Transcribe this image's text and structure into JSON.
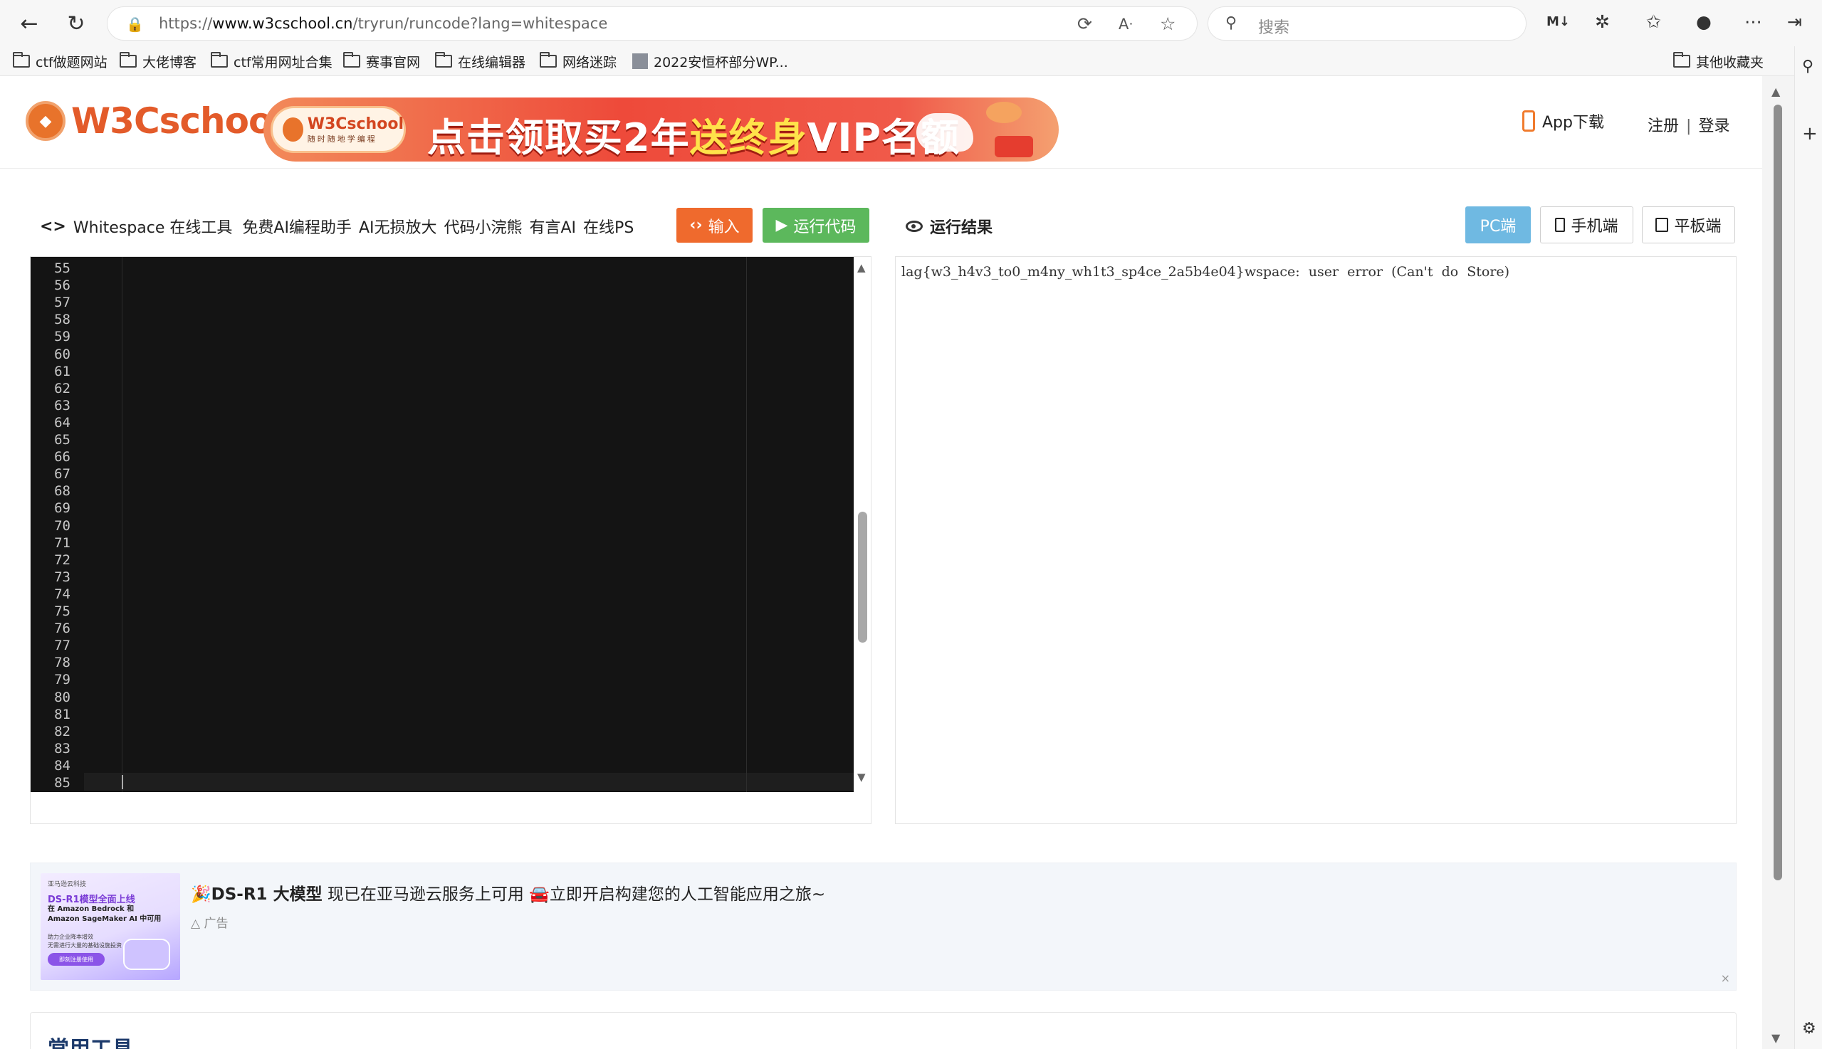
{
  "browser": {
    "url_prefix": "https://",
    "url_host": "www.w3cschool.cn",
    "url_path": "/tryrun/runcode?lang=whitespace",
    "search_placeholder": "搜索",
    "bookmarks": [
      {
        "label": "ctf做题网站",
        "type": "folder"
      },
      {
        "label": "大佬博客",
        "type": "folder"
      },
      {
        "label": "ctf常用网址合集",
        "type": "folder"
      },
      {
        "label": "赛事官网",
        "type": "folder"
      },
      {
        "label": "在线编辑器",
        "type": "folder"
      },
      {
        "label": "网络迷踪",
        "type": "folder"
      },
      {
        "label": "2022安恒杯部分WP...",
        "type": "page"
      }
    ],
    "other_bookmarks": "其他收藏夹"
  },
  "header": {
    "logo_text": "W3Cschool",
    "banner": {
      "badge_name": "W3Cschool",
      "badge_slogan": "随时随地学编程",
      "promo_a": "点击领取买2年",
      "promo_b": "送终身",
      "promo_c": "VIP名额"
    },
    "app_download": "App下载",
    "register": "注册",
    "separator": "|",
    "login": "登录"
  },
  "toolbar": {
    "tool_icon": "<>",
    "tool_title": "Whitespace 在线工具",
    "links": [
      "免费AI编程助手",
      "AI无损放大",
      "代码小浣熊",
      "有言AI",
      "在线PS"
    ],
    "input_label": "输入",
    "run_label": "运行代码",
    "result_label": "运行结果",
    "device_buttons": {
      "pc": "PC端",
      "mobile": "手机端",
      "tablet": "平板端"
    }
  },
  "editor": {
    "line_numbers": [
      "55",
      "56",
      "57",
      "58",
      "59",
      "60",
      "61",
      "62",
      "63",
      "64",
      "65",
      "66",
      "67",
      "68",
      "69",
      "70",
      "71",
      "72",
      "73",
      "74",
      "75",
      "76",
      "77",
      "78",
      "79",
      "80",
      "81",
      "82",
      "83",
      "84",
      "85"
    ]
  },
  "result": {
    "output": "lag{w3_h4v3_to0_m4ny_wh1t3_sp4ce_2a5b4e04}wspace:  user  error  (Can't  do  Store)"
  },
  "ad": {
    "image_lines": {
      "l1": "亚马逊云科技",
      "l2": "DS-R1模型全面上线",
      "l3a": "在 Amazon Bedrock 和",
      "l3b": "Amazon SageMaker AI 中可用",
      "l4a": "助力企业降本增效",
      "l4b": "无需进行大量的基础设施投资",
      "cta": "即刻注册使用"
    },
    "headline_emoji": "🎉",
    "headline_bold": "DS-R1 大模型",
    "headline_rest": " 现已在亚马逊云服务上可用 ",
    "headline_emoji2": "🚘",
    "headline_tail": "立即开启构建您的人工智能应用之旅~",
    "label": "广告",
    "close": "×"
  },
  "common_tools": {
    "title": "常用工具"
  }
}
